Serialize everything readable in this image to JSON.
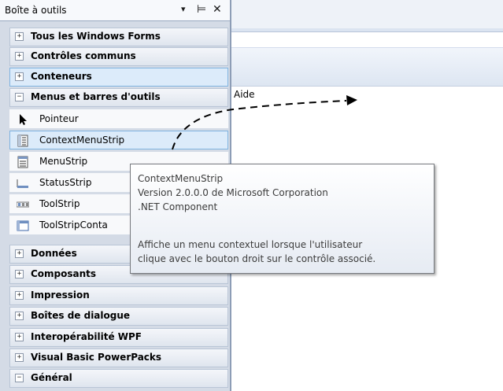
{
  "toolbox": {
    "title": "Boîte à outils",
    "header_buttons": {
      "dropdown": "▾",
      "pin": "⊨",
      "close": "✕"
    }
  },
  "categories": [
    {
      "sign": "+",
      "label": "Tous les Windows Forms"
    },
    {
      "sign": "+",
      "label": "Contrôles communs"
    },
    {
      "sign": "+",
      "label": "Conteneurs"
    },
    {
      "sign": "−",
      "label": "Menus et barres d'outils"
    }
  ],
  "items": [
    {
      "label": "Pointeur",
      "icon": "pointer-icon"
    },
    {
      "label": "ContextMenuStrip",
      "icon": "context-menu-icon"
    },
    {
      "label": "MenuStrip",
      "icon": "menustrip-icon"
    },
    {
      "label": "StatusStrip",
      "icon": "statusstrip-icon"
    },
    {
      "label": "ToolStrip",
      "icon": "toolstrip-icon"
    },
    {
      "label": "ToolStripConta",
      "icon": "toolstrip-container-icon"
    }
  ],
  "categories_after": [
    {
      "sign": "+",
      "label": "Données"
    },
    {
      "sign": "+",
      "label": "Composants"
    },
    {
      "sign": "+",
      "label": "Impression"
    },
    {
      "sign": "+",
      "label": "Boîtes de dialogue"
    },
    {
      "sign": "+",
      "label": "Interopérabilité WPF"
    },
    {
      "sign": "+",
      "label": "Visual Basic PowerPacks"
    },
    {
      "sign": "−",
      "label": "Général"
    }
  ],
  "tooltip": {
    "line1": "ContextMenuStrip",
    "line2": "Version 2.0.0.0 de Microsoft Corporation",
    "line3": ".NET Component",
    "line4": "Affiche un menu contextuel lorsque l'utilisateur",
    "line5": "clique avec le bouton droit sur le contrôle associé."
  },
  "designer": {
    "menu_aide": "Aide"
  },
  "colors": {
    "highlight": "#dcebfa",
    "highlight_border": "#7fb3e0",
    "panel": "#d4dbe6"
  }
}
